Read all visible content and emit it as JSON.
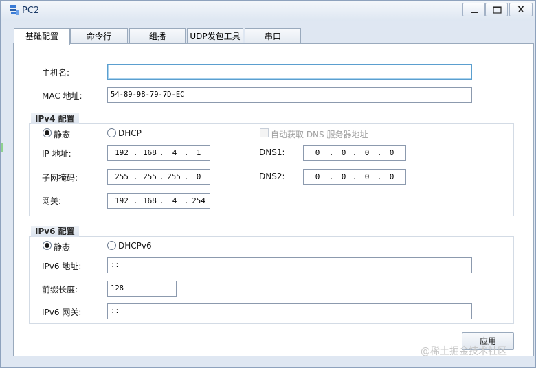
{
  "window": {
    "title": "PC2",
    "icon": "pc-app-icon",
    "controls": {
      "minimize_icon": "minimize-icon",
      "maximize_icon": "maximize-icon",
      "close_label": "X"
    }
  },
  "tabs": [
    {
      "label": "基础配置",
      "active": true
    },
    {
      "label": "命令行",
      "active": false
    },
    {
      "label": "组播",
      "active": false
    },
    {
      "label": "UDP发包工具",
      "active": false
    },
    {
      "label": "串口",
      "active": false
    }
  ],
  "basic": {
    "hostname_label": "主机名:",
    "hostname_value": "",
    "mac_label": "MAC 地址:",
    "mac_value": "54-89-98-79-7D-EC"
  },
  "ipv4": {
    "group_title": "IPv4 配置",
    "static_label": "静态",
    "static_selected": true,
    "dhcp_label": "DHCP",
    "auto_dns_label": "自动获取 DNS 服务器地址",
    "ip_label": "IP 地址:",
    "ip": [
      "192",
      "168",
      "4",
      "1"
    ],
    "mask_label": "子网掩码:",
    "mask": [
      "255",
      "255",
      "255",
      "0"
    ],
    "gateway_label": "网关:",
    "gateway": [
      "192",
      "168",
      "4",
      "254"
    ],
    "dns1_label": "DNS1:",
    "dns1": [
      "0",
      "0",
      "0",
      "0"
    ],
    "dns2_label": "DNS2:",
    "dns2": [
      "0",
      "0",
      "0",
      "0"
    ]
  },
  "ipv6": {
    "group_title": "IPv6 配置",
    "static_label": "静态",
    "static_selected": true,
    "dhcp_label": "DHCPv6",
    "address_label": "IPv6 地址:",
    "address_value": "::",
    "prefix_label": "前缀长度:",
    "prefix_value": "128",
    "gateway_label": "IPv6 网关:",
    "gateway_value": "::"
  },
  "apply_label": "应用",
  "watermark": "@稀土掘金技术社区"
}
